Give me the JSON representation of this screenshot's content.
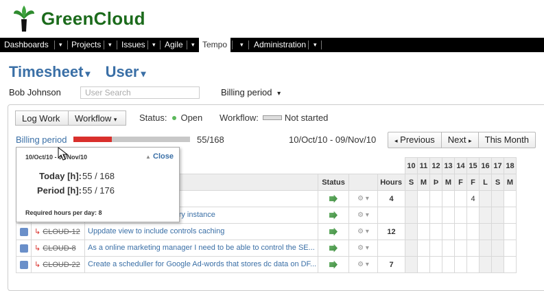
{
  "app": {
    "brand": "GreenCloud"
  },
  "topnav": {
    "items": [
      "Dashboards",
      "Projects",
      "Issues",
      "Agile",
      "Tempo",
      "Administration"
    ],
    "active": "Tempo"
  },
  "heading": {
    "title": "Timesheet",
    "user_title": "User"
  },
  "user": {
    "name": "Bob Johnson",
    "search_placeholder": "User Search",
    "billing_select": "Billing period"
  },
  "toolbar": {
    "log_work": "Log Work",
    "workflow": "Workflow",
    "status_label": "Status:",
    "status_value": "Open",
    "workflow_label": "Workflow:",
    "workflow_value": "Not started"
  },
  "billing": {
    "link": "Billing period",
    "progress_text": "55/168",
    "progress_fraction": 0.327,
    "range": "10/Oct/10 - 09/Nov/10",
    "prev": "Previous",
    "next": "Next",
    "this_month": "This Month"
  },
  "popup": {
    "dates": "10/Oct/10 - 09/Nov/10",
    "close": "Close",
    "today_label": "Today [h]:",
    "today_value": "55 / 168",
    "period_label": "Period [h]:",
    "period_value": "55 / 176",
    "required": "Required hours per day: 8"
  },
  "table": {
    "headers": {
      "status": "Status",
      "hours": "Hours"
    },
    "day_numbers": [
      "10",
      "11",
      "12",
      "13",
      "14",
      "15",
      "16",
      "17",
      "18"
    ],
    "day_letters": [
      "S",
      "M",
      "Þ",
      "M",
      "F",
      "F",
      "L",
      "S",
      "M"
    ],
    "rows": [
      {
        "key": "",
        "summary": "th Apple ipad - login error",
        "hours": "4",
        "day_values": [
          "",
          "",
          "",
          "",
          "",
          "4",
          "",
          "",
          ""
        ]
      },
      {
        "key": "",
        "summary": "be able reset cache for every instance",
        "hours": "",
        "day_values": [
          "",
          "",
          "",
          "",
          "",
          "",
          "",
          "",
          ""
        ]
      },
      {
        "key": "CLOUD-12",
        "summary": "Uppdate view to include controls caching",
        "hours": "12",
        "day_values": [
          "",
          "",
          "",
          "",
          "",
          "",
          "",
          "",
          ""
        ]
      },
      {
        "key": "CLOUD-8",
        "summary": "As a online marketing manager I need to be able to control the SE...",
        "hours": "",
        "day_values": [
          "",
          "",
          "",
          "",
          "",
          "",
          "",
          "",
          ""
        ]
      },
      {
        "key": "CLOUD-22",
        "summary": "Create a scheduller for Google Ad-words that stores dc data on DF...",
        "hours": "7",
        "day_values": [
          "",
          "",
          "",
          "",
          "",
          "",
          "",
          "",
          ""
        ]
      }
    ]
  },
  "colors": {
    "brand_green": "#1c6b1c",
    "link_blue": "#3a6fa6",
    "progress_red": "#d9302c",
    "nav_black": "#000000"
  }
}
